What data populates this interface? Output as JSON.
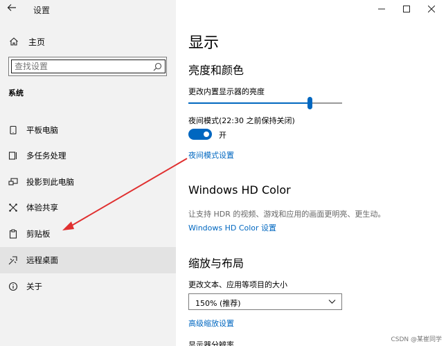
{
  "window": {
    "title": "设置",
    "back_icon": "back-arrow-icon",
    "controls": [
      "minimize-icon",
      "maximize-icon",
      "close-icon"
    ]
  },
  "sidebar": {
    "home_label": "主页",
    "search_placeholder": "查找设置",
    "section_label": "系统",
    "items": [
      {
        "label": "平板电脑",
        "icon": "tablet-icon"
      },
      {
        "label": "多任务处理",
        "icon": "multitask-icon"
      },
      {
        "label": "投影到此电脑",
        "icon": "project-icon"
      },
      {
        "label": "体验共享",
        "icon": "share-icon"
      },
      {
        "label": "剪贴板",
        "icon": "clipboard-icon"
      },
      {
        "label": "远程桌面",
        "icon": "remote-desktop-icon",
        "selected": true
      },
      {
        "label": "关于",
        "icon": "info-icon"
      }
    ]
  },
  "main": {
    "page_title": "显示",
    "brightness": {
      "heading": "亮度和颜色",
      "slider_label": "更改内置显示器的亮度",
      "slider_fraction": 0.79
    },
    "night_light": {
      "label": "夜间模式(22:30 之前保持关闭)",
      "toggle_state": "开",
      "settings_link": "夜间模式设置"
    },
    "hdr": {
      "heading": "Windows HD Color",
      "description": "让支持 HDR 的视频、游戏和应用的画面更明亮、更生动。",
      "settings_link": "Windows HD Color 设置"
    },
    "scale": {
      "heading": "缩放与布局",
      "label": "更改文本、应用等项目的大小",
      "selected_value": "150% (推荐)",
      "advanced_link": "高级缩放设置",
      "resolution_label": "显示器分辨率"
    }
  },
  "watermark": "CSDN @某崔同学",
  "annotation_arrow_color": "#e03030"
}
